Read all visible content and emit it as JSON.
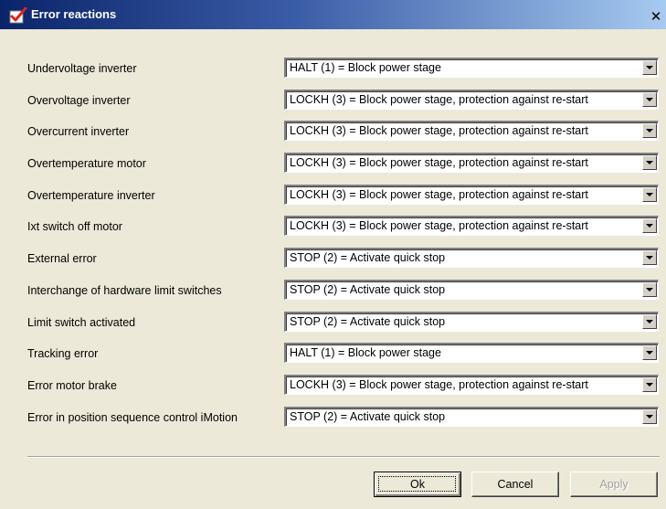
{
  "window": {
    "title": "Error reactions",
    "close_glyph": "✕",
    "icon": "app-icon-red-check"
  },
  "rows": [
    {
      "label": "Undervoltage inverter",
      "value": "HALT (1) = Block power stage"
    },
    {
      "label": "Overvoltage inverter",
      "value": "LOCKH (3) = Block power stage, protection against re-start"
    },
    {
      "label": "Overcurrent inverter",
      "value": "LOCKH (3) = Block power stage, protection against re-start"
    },
    {
      "label": "Overtemperature motor",
      "value": "LOCKH (3) = Block power stage, protection against re-start"
    },
    {
      "label": "Overtemperature inverter",
      "value": "LOCKH (3) = Block power stage, protection against re-start"
    },
    {
      "label": "Ixt switch off motor",
      "value": "LOCKH (3) = Block power stage, protection against re-start"
    },
    {
      "label": "External error",
      "value": "STOP (2) = Activate quick stop"
    },
    {
      "label": "Interchange of hardware limit switches",
      "value": "STOP (2) = Activate quick stop"
    },
    {
      "label": "Limit switch activated",
      "value": "STOP (2) = Activate quick stop"
    },
    {
      "label": "Tracking error",
      "value": "HALT (1) = Block power stage"
    },
    {
      "label": "Error motor brake",
      "value": "LOCKH (3) = Block power stage, protection against re-start"
    },
    {
      "label": "Error in position sequence control iMotion",
      "value": "STOP (2) = Activate quick stop"
    }
  ],
  "buttons": {
    "ok": "Ok",
    "cancel": "Cancel",
    "apply": "Apply"
  },
  "colors": {
    "titlebar_start": "#0a246a",
    "titlebar_end": "#a6caf0",
    "dialog_bg": "#ece9d8"
  }
}
